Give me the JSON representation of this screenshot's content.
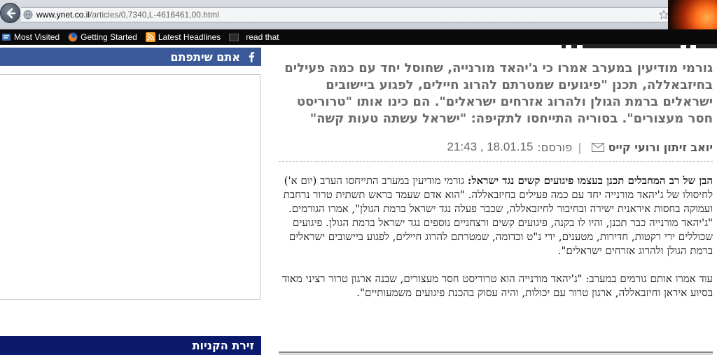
{
  "browser": {
    "url_domain": "www.ynet.co.il",
    "url_path": "/articles/0,7340,L-4616461,00.html",
    "bookmarks": [
      {
        "label": "Most Visited",
        "icon": "bookmark-star-icon"
      },
      {
        "label": "Getting Started",
        "icon": "firefox-icon"
      },
      {
        "label": "Latest Headlines",
        "icon": "rss-icon"
      },
      {
        "label": "read that",
        "icon": "folder-icon"
      }
    ]
  },
  "article": {
    "subtitle": "גורמי מודיעין במערב אמרו כי ג'יהאד מורנייה, שחוסל יחד עם כמה פעילים בחיזבאללה, תכנן \"פיגועים שמטרתם להרוג חיילים, לפגוע ביישובים ישראלים ברמת הגולן ולהרוג אזרחים ישראלים\". הם כינו אותו \"טרוריסט חסר מעצורים\". בסוריה התייחסו לתקיפה: \"ישראל עשתה טעות קשה\"",
    "authors": "יואב זיתון ורועי קייס",
    "published_label": "פורסם:",
    "published_date": "18.01.15 , 21:43",
    "lead": "הבן של רב המחבלים תכנן בעצמו פיגועים קשים נגד ישראל:",
    "paragraph1": " גורמי מודיעין במערב התייחסו הערב (יום א') לחיסולו של ג'יהאד מורנייה יחד עם כמה פעילים בחיזבאללה. \"הוא אדם שעמד בראש תשתית טרור נרחבת ועמוקה בחסות איראנית ישירה ובחיבור לחיזבאללה, שכבר פעלה נגד ישראל ברמת הגולן\", אמרו הגורמים. \"ג'יהאד מורנייה כבר תכנן, והיו לו בקנה, פיגועים קשים ורצחניים נוספים נגד ישראל ברמת הגולן. פיגועים שכוללים ירי רקטות, חדירות, מטענים, ירי נ\"ט וכדומה, שמטרתם להרוג חיילים, לפגוע ביישובים ישראלים ברמת הגולן ולהרוג אזרחים ישראלים\".",
    "paragraph2": "עוד אמרו אותם גורמים במערב: \"ג'יהאד מורנייה הוא טרוריסט חסר מעצורים, שבנה ארגון טרור רציני מאוד בסיוע איראן וחיזבאללה, ארגון טרור עם יכולות, והיה עסוק בהכנת פיגועים משמעותיים\"."
  },
  "sidebar": {
    "facebook_title": "אתם שיתפתם",
    "shopping_title": "זירת הקניות"
  },
  "colors": {
    "facebook_blue": "#3b5998",
    "shopping_navy": "#0b1a6b",
    "subtitle_gray": "#6b6b6b"
  }
}
